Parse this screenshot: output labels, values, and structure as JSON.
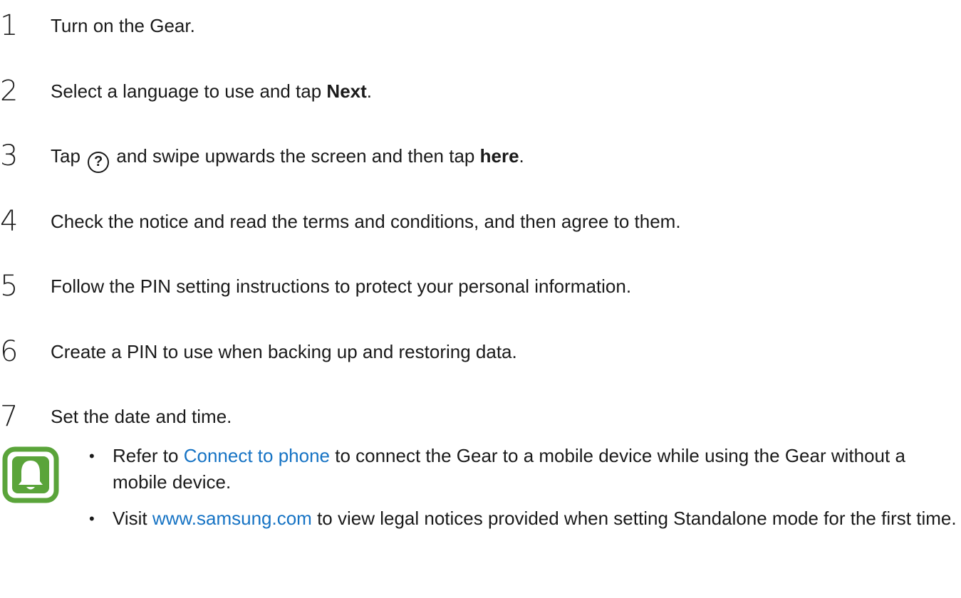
{
  "steps": [
    {
      "num": "1",
      "text": "Turn on the Gear."
    },
    {
      "num": "2",
      "pre": "Select a language to use and tap ",
      "bold": "Next",
      "post": "."
    },
    {
      "num": "3",
      "pre": "Tap ",
      "icon": "?",
      "mid": " and swipe upwards the screen and then tap ",
      "bold": "here",
      "post": "."
    },
    {
      "num": "4",
      "text": "Check the notice and read the terms and conditions, and then agree to them."
    },
    {
      "num": "5",
      "text": "Follow the PIN setting instructions to protect your personal information."
    },
    {
      "num": "6",
      "text": "Create a PIN to use when backing up and restoring data."
    },
    {
      "num": "7",
      "text": "Set the date and time."
    }
  ],
  "note": {
    "icon": "notification-bell-icon",
    "icon_color": "#5aa43a",
    "items": [
      {
        "bullet": "•",
        "pre": "Refer to ",
        "link": "Connect to phone",
        "post": " to connect the Gear to a mobile device while using the Gear without a mobile device."
      },
      {
        "bullet": "•",
        "pre": "Visit ",
        "link": "www.samsung.com",
        "post": " to view legal notices provided when setting Standalone mode for the first time."
      }
    ]
  },
  "colors": {
    "link": "#1673c4",
    "text": "#1a1a1a"
  }
}
